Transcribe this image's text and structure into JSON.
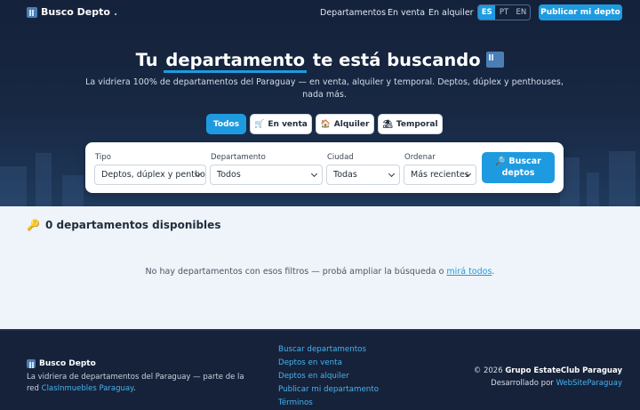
{
  "brand": {
    "name": "Busco Depto",
    "dot": "."
  },
  "nav": {
    "items": [
      "Departamentos",
      "En venta",
      "En alquiler"
    ]
  },
  "languages": {
    "es": "ES",
    "pt": "PT",
    "en": "EN",
    "active": "ES"
  },
  "header": {
    "publish_label": "Publicar mi depto"
  },
  "hero": {
    "title_pre": "Tu",
    "title_highlight": "departamento",
    "title_post": "te está buscando",
    "subtitle": "La vidriera 100% de departamentos del Paraguay — en venta, alquiler y temporal. Deptos, dúplex y penthouses, nada más."
  },
  "filter_tabs": {
    "all": "Todos",
    "sale": "En venta",
    "rent": "Alquiler",
    "temporary": "Temporal"
  },
  "search": {
    "tipo_label": "Tipo",
    "tipo_value": "Deptos, dúplex y penthouses",
    "departamento_label": "Departamento",
    "departamento_value": "Todos",
    "ciudad_label": "Ciudad",
    "ciudad_value": "Todas",
    "ordenar_label": "Ordenar",
    "ordenar_value": "Más recientes",
    "button_line1": "Buscar",
    "button_line2": "deptos"
  },
  "results": {
    "title": "0 departamentos disponibles",
    "empty_text": "No hay departamentos con esos filtros — probá ampliar la búsqueda o",
    "empty_link": "mirá todos",
    "empty_end": "."
  },
  "footer": {
    "brand": "Busco Depto",
    "desc_line1": "La vidriera de departamentos del Paraguay — parte de la red",
    "desc_link": "ClasInmuebles Paraguay",
    "desc_end": ".",
    "links": [
      "Buscar departamentos",
      "Deptos en venta",
      "Deptos en alquiler",
      "Publicar mi departamento",
      "Términos"
    ],
    "copyright_pre": "© 2026",
    "copyright_company": "Grupo EstateClub Paraguay",
    "developed_pre": "Desarrollado por",
    "developed_link": "WebSiteParaguay"
  },
  "colors": {
    "accent": "#1e9be0",
    "hero_bg": "#182843",
    "footer_bg": "#16223a",
    "page_bg": "#eef4f9"
  }
}
